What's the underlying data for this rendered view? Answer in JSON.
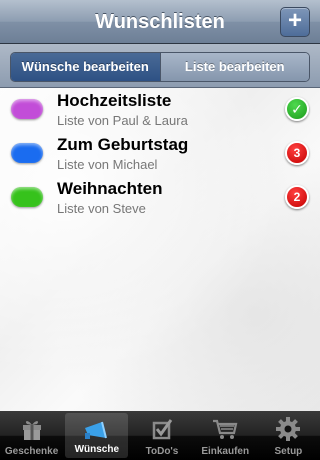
{
  "navbar": {
    "title": "Wunschlisten",
    "add_label": "+"
  },
  "segments": [
    {
      "label": "Wünsche bearbeiten",
      "selected": true
    },
    {
      "label": "Liste bearbeiten",
      "selected": false
    }
  ],
  "lists": [
    {
      "title": "Hochzeitsliste",
      "subtitle": "Liste von Paul & Laura",
      "color": "#c24dd8",
      "badge": "✓",
      "badge_type": "check"
    },
    {
      "title": "Zum Geburtstag",
      "subtitle": "Liste von Michael",
      "color": "#1a6cf0",
      "badge": "3",
      "badge_type": "count"
    },
    {
      "title": "Weihnachten",
      "subtitle": "Liste von Steve",
      "color": "#36c21c",
      "badge": "2",
      "badge_type": "count"
    }
  ],
  "tabs": [
    {
      "label": "Geschenke",
      "icon": "gift-icon",
      "active": false
    },
    {
      "label": "Wünsche",
      "icon": "megaphone-icon",
      "active": true
    },
    {
      "label": "ToDo's",
      "icon": "checkbox-icon",
      "active": false
    },
    {
      "label": "Einkaufen",
      "icon": "cart-icon",
      "active": false
    },
    {
      "label": "Setup",
      "icon": "gear-icon",
      "active": false
    }
  ],
  "colors": {
    "accent": "#2e5184",
    "badge_red": "#d40000",
    "badge_green": "#1d9b1d"
  }
}
